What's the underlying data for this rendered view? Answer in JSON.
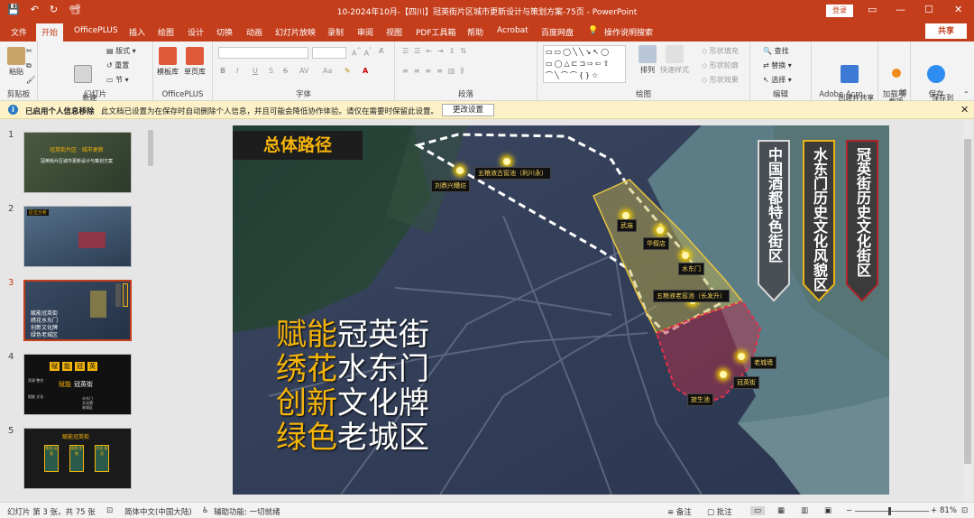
{
  "window": {
    "title": "10-2024年10月-【四川】冠英街片区城市更新设计与策划方案-75页  -  PowerPoint",
    "login": "登录",
    "minimize": "—",
    "maximize": "☐",
    "close": "✕"
  },
  "qat": {
    "save": "💾",
    "undo": "↶",
    "redo": "↻",
    "present": "📽"
  },
  "tabs": [
    "文件",
    "开始",
    "OfficePLUS",
    "插入",
    "绘图",
    "设计",
    "切换",
    "动画",
    "幻灯片放映",
    "录制",
    "审阅",
    "视图",
    "PDF工具箱",
    "帮助",
    "Acrobat",
    "百度网盘"
  ],
  "active_tab": "开始",
  "tellme": "操作说明搜索",
  "share": "共享",
  "ribbon": {
    "clipboard": {
      "paste": "粘贴",
      "group": "剪贴板"
    },
    "slides": {
      "new_slide": "新建\n幻灯片",
      "layout": "版式",
      "reset": "重置",
      "section": "节",
      "group": "幻灯片"
    },
    "officeplus": {
      "template": "模板库",
      "single": "单页库",
      "group": "OfficePLUS"
    },
    "font": {
      "bold": "B",
      "italic": "I",
      "underline": "U",
      "strike": "S",
      "shadow": "S",
      "spacing": "AV",
      "case": "Aa",
      "color": "A",
      "group": "字体"
    },
    "paragraph": {
      "group": "段落"
    },
    "drawing": {
      "arrange": "排列",
      "quickstyle": "快速样式",
      "fill": "形状填充",
      "outline": "形状轮廓",
      "effect": "形状效果",
      "group": "绘图"
    },
    "editing": {
      "find": "查找",
      "replace": "替换",
      "select": "选择",
      "group": "编辑"
    },
    "adobe": {
      "create": "创建并共享\nAdobe PDF",
      "group": "Adobe Acro..."
    },
    "addins": {
      "addin": "加\n载项",
      "group": "加载项"
    },
    "save": {
      "baidu": "保存到\n百度网盘",
      "group": "保存"
    }
  },
  "infobar": {
    "title": "已启用个人信息移除",
    "message": "此文档已设置为在保存时自动删除个人信息，并且可能会降低协作体验。请仅在需要时保留此设置。",
    "button": "更改设置",
    "close": "✕"
  },
  "thumbnails": [
    {
      "num": "1",
      "texts": [
        "冠英街片区 · 城市更新",
        "冠英街片区城市更新设计与策划方案"
      ]
    },
    {
      "num": "2",
      "texts": [
        "区位分析"
      ]
    },
    {
      "num": "3",
      "texts": [
        "赋能冠英街",
        "绣花水东门",
        "创新文化牌",
        "绿色老城区"
      ]
    },
    {
      "num": "4",
      "texts": [
        "赋",
        "能",
        "冠",
        "英",
        "赋能",
        "冠英街",
        "资源 整合",
        "赋能 文化",
        "水东门",
        "文化牌",
        "老城区"
      ]
    },
    {
      "num": "5",
      "texts": [
        "赋能冠英街",
        "策划 运营",
        "规划 定制",
        "文化 彰显"
      ]
    }
  ],
  "slide": {
    "title": "总体路径",
    "slogans": [
      {
        "y": "赋能",
        "w": "冠英街"
      },
      {
        "y": "绣花",
        "w": "水东门"
      },
      {
        "y": "创新",
        "w": "文化牌"
      },
      {
        "y": "绿色",
        "w": "老城区"
      }
    ],
    "banners": [
      {
        "text": "中国酒都特色街区",
        "color": "#4a4e55",
        "border": "#d9d9d9"
      },
      {
        "text": "水东门历史文化风貌区",
        "color": "#3b3b3b",
        "border": "#e8b417"
      },
      {
        "text": "冠英街历史文化街区",
        "color": "#3b3b3b",
        "border": "#b0232a"
      }
    ],
    "pois": [
      "刘鼎兴糟坊",
      "五粮液古窖池（利川永）",
      "武庙",
      "华叙店",
      "水东门",
      "五粮液老窖池（长发升）",
      "老城墙",
      "冠英街",
      "旅生池"
    ]
  },
  "status": {
    "slide_info": "幻灯片 第 3 张，共 75 张",
    "lang": "简体中文(中国大陆)",
    "access": "辅助功能: 一切就绪",
    "notes": "备注",
    "comments": "批注",
    "zoom": "81%",
    "minus": "−",
    "plus": "+"
  }
}
